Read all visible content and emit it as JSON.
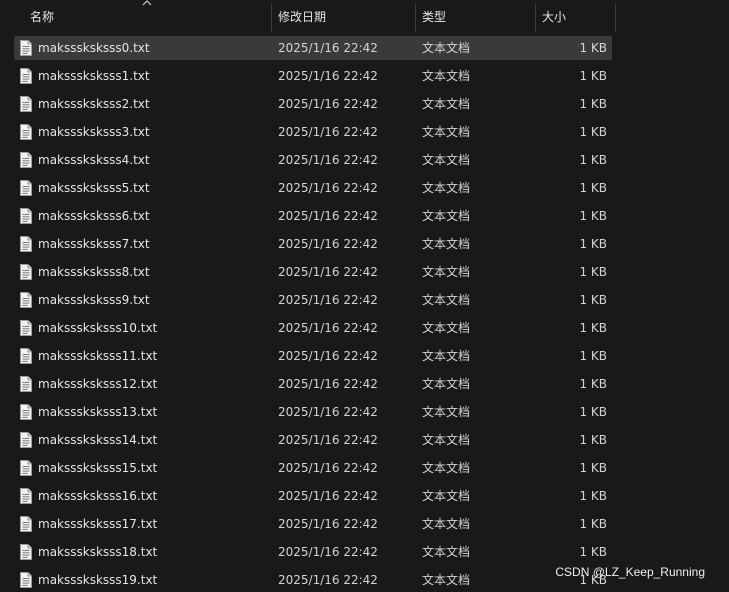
{
  "columns": {
    "name": "名称",
    "date": "修改日期",
    "type": "类型",
    "size": "大小"
  },
  "sort_icon": "chevron-up-icon",
  "file_icon": "text-document-icon",
  "files": [
    {
      "name": "maksssksksss0.txt",
      "date": "2025/1/16 22:42",
      "type": "文本文档",
      "size": "1 KB",
      "selected": true
    },
    {
      "name": "maksssksksss1.txt",
      "date": "2025/1/16 22:42",
      "type": "文本文档",
      "size": "1 KB"
    },
    {
      "name": "maksssksksss2.txt",
      "date": "2025/1/16 22:42",
      "type": "文本文档",
      "size": "1 KB"
    },
    {
      "name": "maksssksksss3.txt",
      "date": "2025/1/16 22:42",
      "type": "文本文档",
      "size": "1 KB"
    },
    {
      "name": "maksssksksss4.txt",
      "date": "2025/1/16 22:42",
      "type": "文本文档",
      "size": "1 KB"
    },
    {
      "name": "maksssksksss5.txt",
      "date": "2025/1/16 22:42",
      "type": "文本文档",
      "size": "1 KB"
    },
    {
      "name": "maksssksksss6.txt",
      "date": "2025/1/16 22:42",
      "type": "文本文档",
      "size": "1 KB"
    },
    {
      "name": "maksssksksss7.txt",
      "date": "2025/1/16 22:42",
      "type": "文本文档",
      "size": "1 KB"
    },
    {
      "name": "maksssksksss8.txt",
      "date": "2025/1/16 22:42",
      "type": "文本文档",
      "size": "1 KB"
    },
    {
      "name": "maksssksksss9.txt",
      "date": "2025/1/16 22:42",
      "type": "文本文档",
      "size": "1 KB"
    },
    {
      "name": "maksssksksss10.txt",
      "date": "2025/1/16 22:42",
      "type": "文本文档",
      "size": "1 KB"
    },
    {
      "name": "maksssksksss11.txt",
      "date": "2025/1/16 22:42",
      "type": "文本文档",
      "size": "1 KB"
    },
    {
      "name": "maksssksksss12.txt",
      "date": "2025/1/16 22:42",
      "type": "文本文档",
      "size": "1 KB"
    },
    {
      "name": "maksssksksss13.txt",
      "date": "2025/1/16 22:42",
      "type": "文本文档",
      "size": "1 KB"
    },
    {
      "name": "maksssksksss14.txt",
      "date": "2025/1/16 22:42",
      "type": "文本文档",
      "size": "1 KB"
    },
    {
      "name": "maksssksksss15.txt",
      "date": "2025/1/16 22:42",
      "type": "文本文档",
      "size": "1 KB"
    },
    {
      "name": "maksssksksss16.txt",
      "date": "2025/1/16 22:42",
      "type": "文本文档",
      "size": "1 KB"
    },
    {
      "name": "maksssksksss17.txt",
      "date": "2025/1/16 22:42",
      "type": "文本文档",
      "size": "1 KB"
    },
    {
      "name": "maksssksksss18.txt",
      "date": "2025/1/16 22:42",
      "type": "文本文档",
      "size": "1 KB"
    },
    {
      "name": "maksssksksss19.txt",
      "date": "2025/1/16 22:42",
      "type": "文本文档",
      "size": "1 KB"
    }
  ],
  "watermark": "CSDN @LZ_Keep_Running",
  "colors": {
    "background": "#191919",
    "selected_row": "#3a3a3a",
    "text": "#e6e6e6"
  }
}
